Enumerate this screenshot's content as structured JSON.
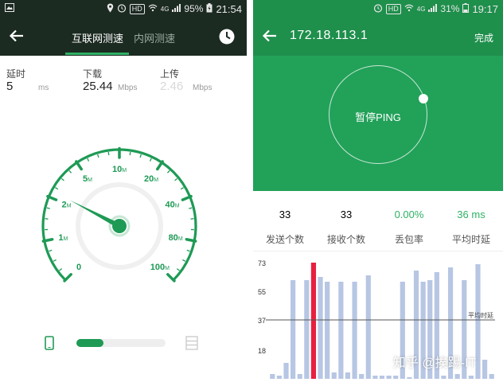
{
  "left": {
    "status": {
      "hd": "HD",
      "network": "4G",
      "battery": "95%",
      "time": "21:54"
    },
    "tabs": [
      "互联网测速",
      "内网测速"
    ],
    "metrics": [
      {
        "label": "延时",
        "value": "5",
        "unit": "ms"
      },
      {
        "label": "下载",
        "value": "25.44",
        "unit": "Mbps"
      },
      {
        "label": "上传",
        "value": "2.46",
        "unit": "Mbps"
      }
    ],
    "gauge": {
      "ticks": [
        {
          "num": "0",
          "unit": ""
        },
        {
          "num": "1",
          "unit": "M"
        },
        {
          "num": "2",
          "unit": "M"
        },
        {
          "num": "5",
          "unit": "M"
        },
        {
          "num": "10",
          "unit": "M"
        },
        {
          "num": "20",
          "unit": "M"
        },
        {
          "num": "40",
          "unit": "M"
        },
        {
          "num": "80",
          "unit": "M"
        },
        {
          "num": "100",
          "unit": "M"
        }
      ],
      "needle_tick_position": 2.15,
      "accent": "#1e9a55"
    },
    "progress": 0.3
  },
  "right": {
    "status": {
      "hd": "HD",
      "network": "4G",
      "battery": "31%",
      "time": "19:17"
    },
    "ip": "172.18.113.1",
    "done_label": "完成",
    "pause_label": "暂停PING",
    "stats": [
      {
        "value": "33",
        "label": "发送个数"
      },
      {
        "value": "33",
        "label": "接收个数"
      },
      {
        "value": "0.00%",
        "label": "丢包率"
      },
      {
        "value": "36 ms",
        "label": "平均时延"
      }
    ],
    "watermark": "知乎 @挨踢-IT"
  },
  "chart_data": {
    "type": "bar",
    "y_ticks": [
      73,
      55,
      37,
      18
    ],
    "ylim": [
      0,
      80
    ],
    "average_value": 37,
    "average_label": "平均时延",
    "values": [
      3,
      2,
      10,
      62,
      3,
      62,
      73,
      64,
      61,
      4,
      61,
      4,
      61,
      3,
      65,
      2,
      2,
      2,
      2,
      61,
      1,
      68,
      61,
      62,
      67,
      2,
      70,
      3,
      62,
      2,
      72,
      12,
      3
    ],
    "highlight_index": 6,
    "colors": {
      "bar": "#b7c6e3",
      "highlight": "#e8203f",
      "average_line": "#555555"
    }
  }
}
